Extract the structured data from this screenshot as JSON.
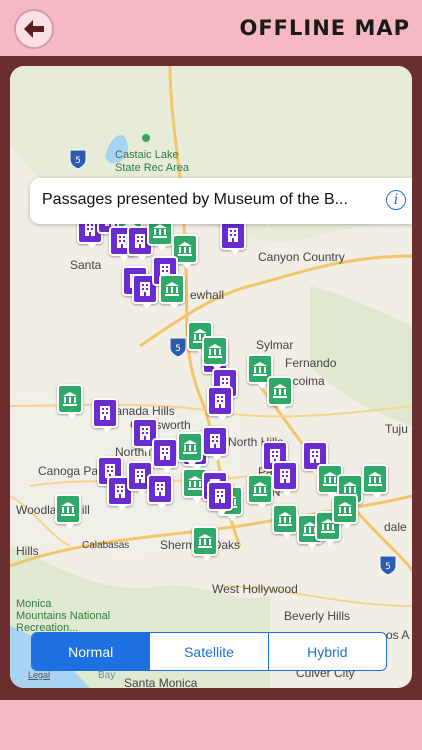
{
  "header": {
    "title": "OFFLINE MAP",
    "back_icon": "arrow-left-icon"
  },
  "callout": {
    "text": "Passages presented by Museum of the B...",
    "info_icon": "info-icon"
  },
  "map_type": {
    "options": [
      "Normal",
      "Satellite",
      "Hybrid"
    ],
    "selected": "Normal"
  },
  "map": {
    "legal": "Legal",
    "labels": {
      "castaic": "Castaic Lake",
      "castaic2": "State Rec Area",
      "canyon_country": "Canyon Country",
      "santa": "Santa",
      "newhall": "ewhall",
      "sylmar": "Sylmar",
      "fernando": "Fernando",
      "pacoima": "Pacoima",
      "tujunga": "Tuju",
      "granada_hills": "Granada Hills",
      "chatsworth": "Chatsworth",
      "north_hills": "North Hills",
      "northridge": "Northri",
      "canoga_park": "Canoga Park",
      "pano": "Pano",
      "van_nuys": "Van N",
      "woodland_hills": "Woodland Hill",
      "calabasas": "Calabasas",
      "sherman_oaks": "Sherman Oaks",
      "hills": "Hills",
      "glendale": "dale",
      "west_hollywood": "West Hollywood",
      "beverly_hills": "Beverly Hills",
      "culver_city": "Culver City",
      "santa_monica": "Santa Monica",
      "santa_monica_mtn": "Monica",
      "mountains": "Mountains National",
      "recreation": "Recreation...",
      "bay": "Bay",
      "los_a": "os A"
    },
    "colors": {
      "museum": "#2fa968",
      "hotel": "#6a2bd0",
      "accent": "#1e6fe0"
    }
  }
}
